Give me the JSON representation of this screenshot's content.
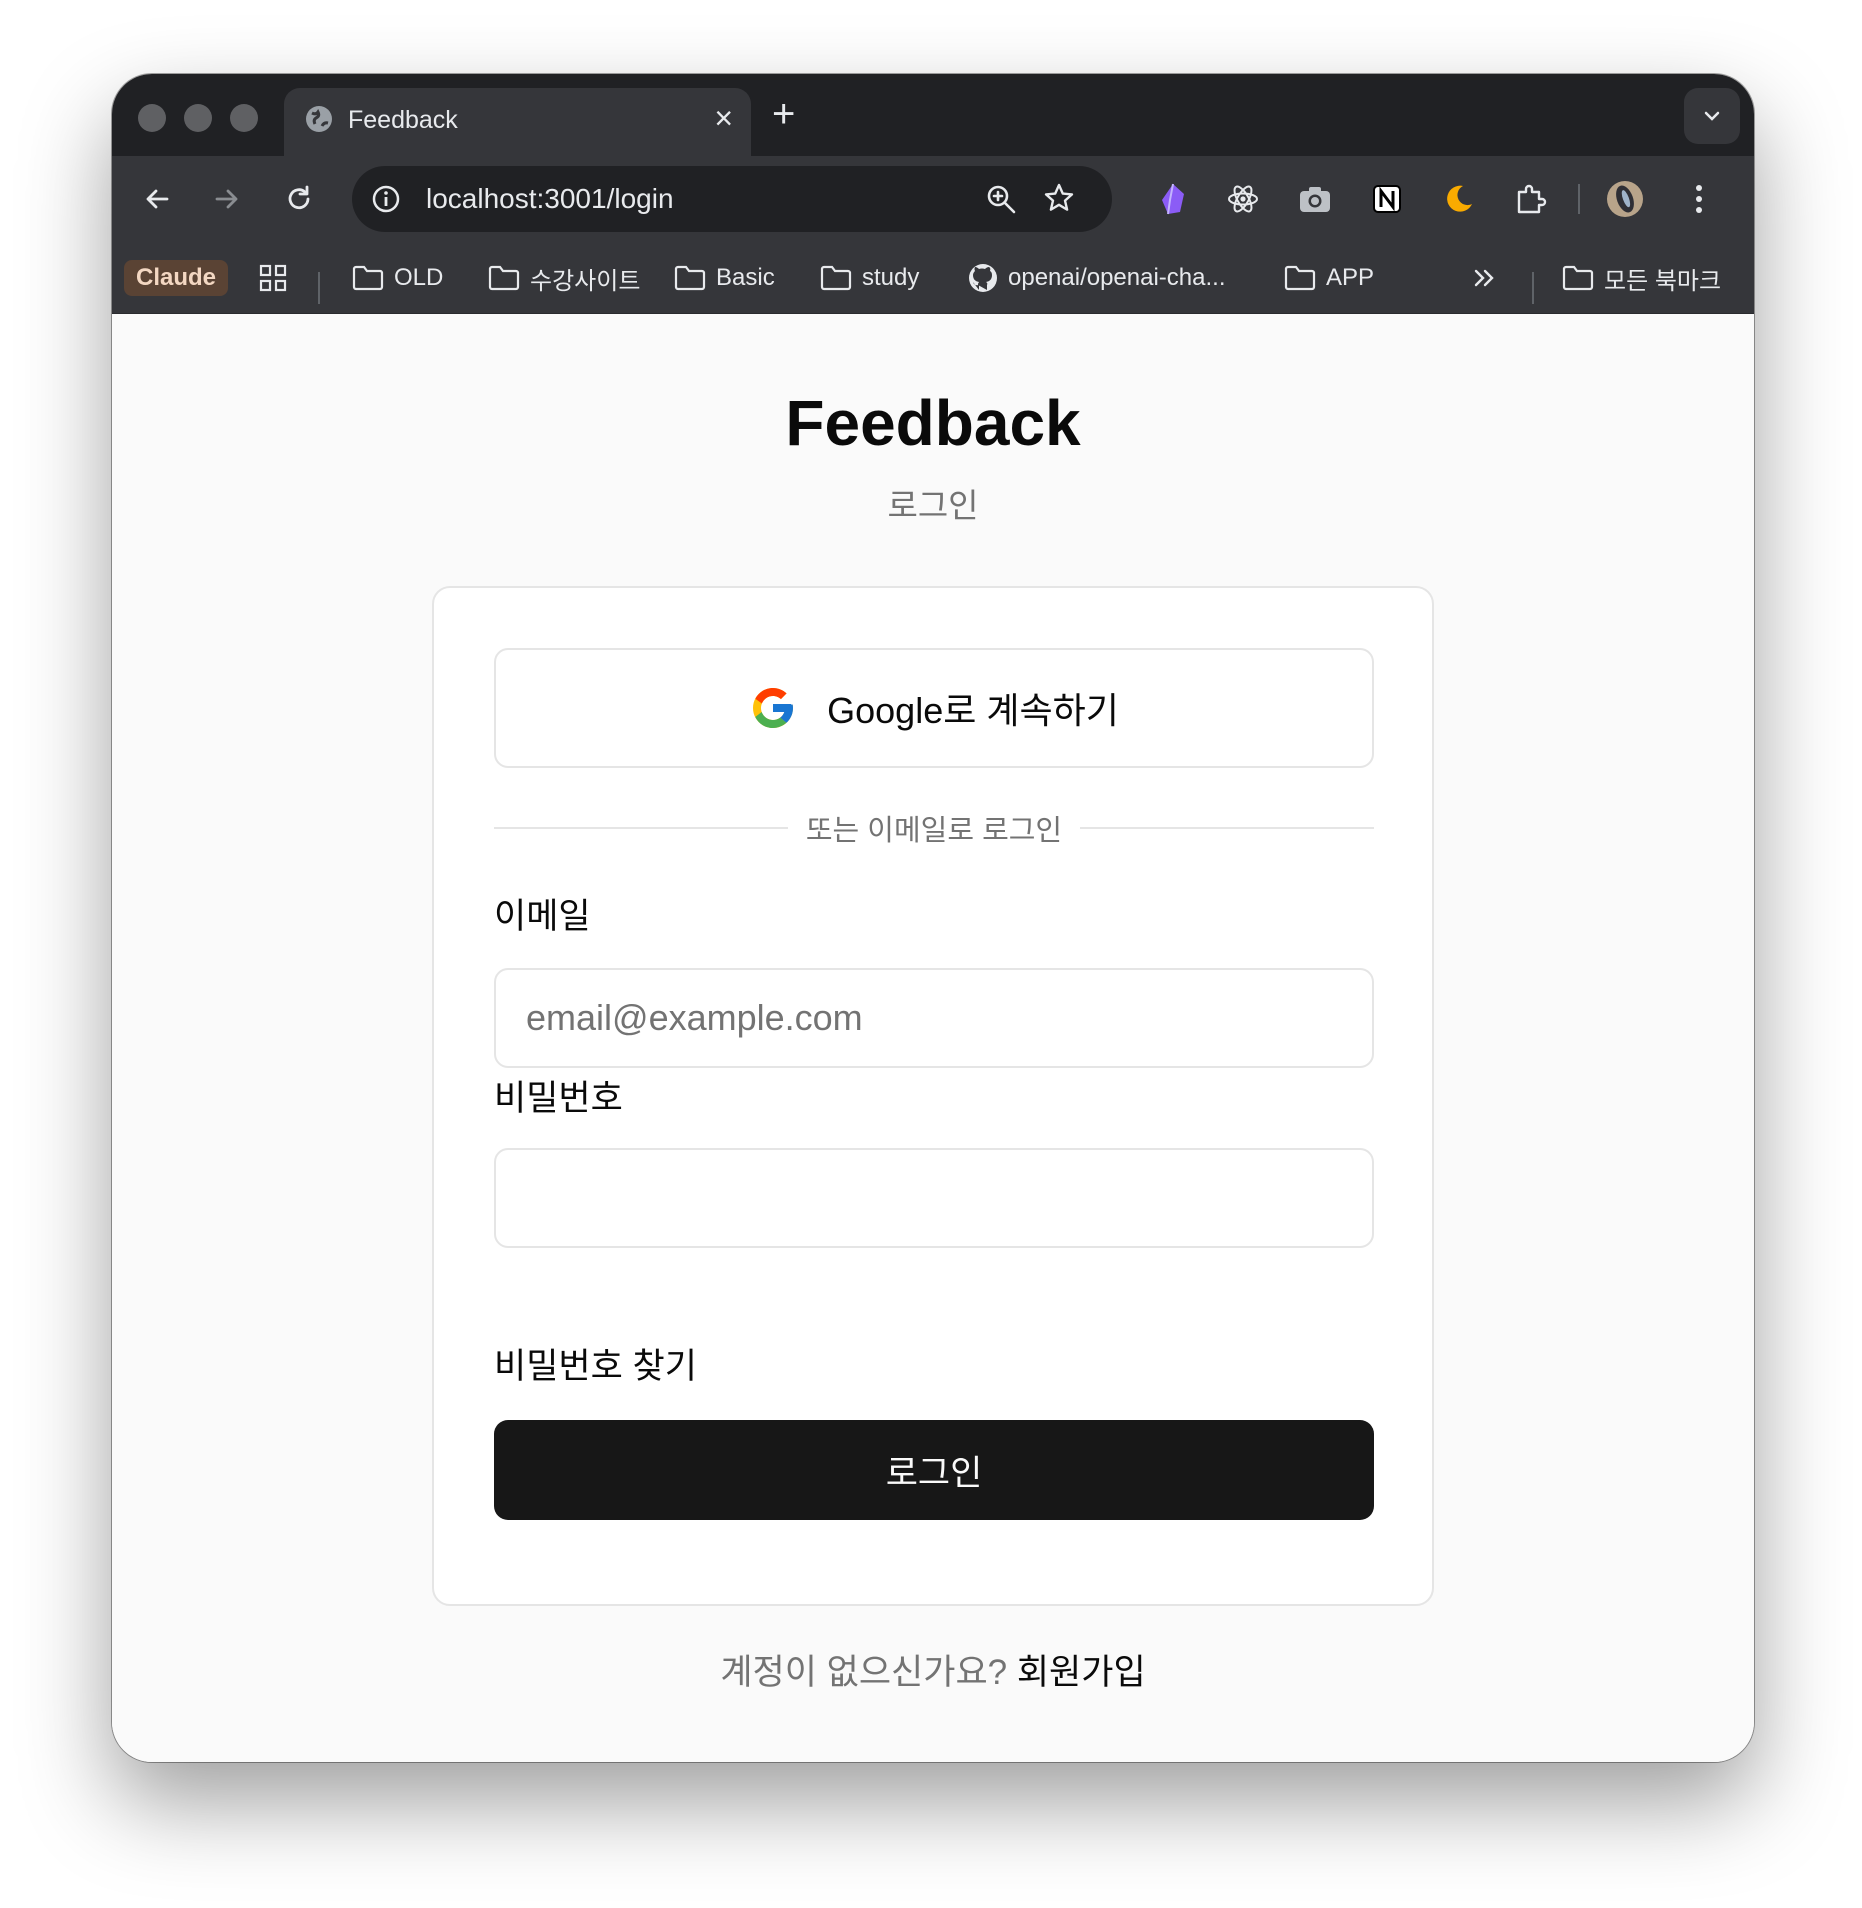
{
  "browser": {
    "tab_title": "Feedback",
    "url": "localhost:3001/login",
    "bookmarks": {
      "claude": "Claude",
      "items": [
        "OLD",
        "수강사이트",
        "Basic",
        "study",
        "openai/openai-cha...",
        "APP"
      ],
      "all_bookmarks": "모든 북마크"
    }
  },
  "page": {
    "title": "Feedback",
    "subtitle": "로그인"
  },
  "login_card": {
    "google_button": "Google로 계속하기",
    "divider_text": "또는 이메일로 로그인",
    "email_label": "이메일",
    "email_placeholder": "email@example.com",
    "email_value": "",
    "password_label": "비밀번호",
    "password_value": "",
    "forgot_password": "비밀번호 찾기",
    "submit": "로그인"
  },
  "footer": {
    "prompt": "계정이 없으신가요?",
    "signup_link": "회원가입"
  },
  "colors": {
    "primary_button": "#171717",
    "muted_text": "#737373",
    "border": "#e5e5e5"
  }
}
